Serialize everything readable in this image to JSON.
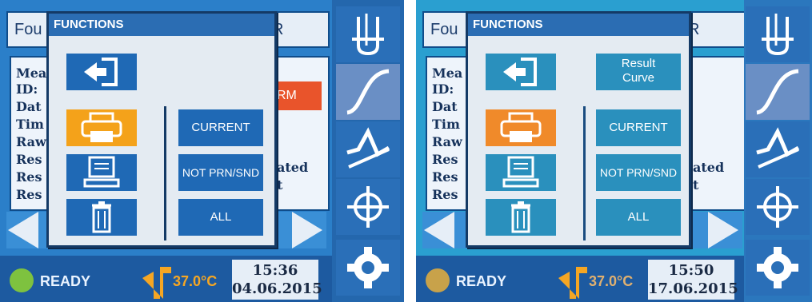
{
  "screens": [
    {
      "title_fragment": "Fou",
      "title_right_fragment": "R",
      "info_rows": [
        "Mea",
        "ID:",
        "Dat",
        "Tim",
        "Raw",
        "Res",
        "Res",
        "Res"
      ],
      "warn_tag": "RM",
      "right_frags": [
        "ated",
        "t"
      ],
      "dialog": {
        "title": "FUNCTIONS",
        "result_curve": {
          "visible": false,
          "line1": "",
          "line2": ""
        },
        "buttons": {
          "current": "CURRENT",
          "not_prn": "NOT PRN/SND",
          "all": "ALL"
        }
      },
      "status": {
        "ready": "READY",
        "temp": "37.0°C",
        "time": "15:36",
        "date": "04.06.2015"
      }
    },
    {
      "title_fragment": "Fou",
      "title_right_fragment": "R",
      "info_rows": [
        "Mea",
        "ID:",
        "Dat",
        "Tim",
        "Raw",
        "Res",
        "Res",
        "Res"
      ],
      "warn_tag": "",
      "right_frags": [
        "ated",
        "t"
      ],
      "dialog": {
        "title": "FUNCTIONS",
        "result_curve": {
          "visible": true,
          "line1": "Result",
          "line2": "Curve"
        },
        "buttons": {
          "current": "CURRENT",
          "not_prn": "NOT PRN/SND",
          "all": "ALL"
        }
      },
      "status": {
        "ready": "READY",
        "temp": "37.0°C",
        "time": "15:50",
        "date": "17.06.2015"
      }
    }
  ],
  "colors": {
    "accent_blue": "#1f69b5",
    "print_orange": "#f4a21a",
    "warn_red": "#e9542b",
    "ready_green": "#7ec23f",
    "temp_orange": "#f5a623"
  },
  "icons": [
    "exit-icon",
    "printer-icon",
    "computer-icon",
    "trash-icon",
    "cuvette-icon",
    "curve-icon",
    "kinetics-icon",
    "crosshair-icon",
    "gear-icon",
    "thermometer-icon"
  ]
}
